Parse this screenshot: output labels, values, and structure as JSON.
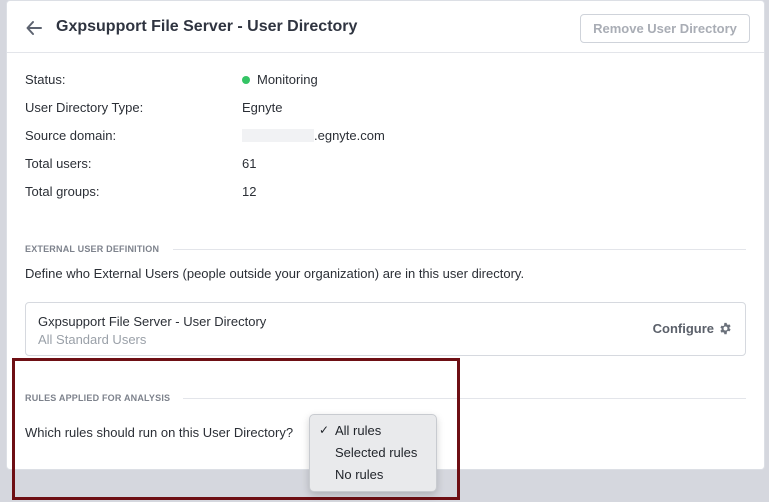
{
  "header": {
    "title": "Gxpsupport File Server - User Directory",
    "remove_label": "Remove User Directory"
  },
  "info": {
    "status_label": "Status:",
    "status_value": "Monitoring",
    "status_color": "#34c465",
    "type_label": "User Directory Type:",
    "type_value": "Egnyte",
    "domain_label": "Source domain:",
    "domain_value": ".egnyte.com",
    "users_label": "Total users:",
    "users_value": "61",
    "groups_label": "Total groups:",
    "groups_value": "12"
  },
  "external": {
    "heading": "EXTERNAL USER DEFINITION",
    "description": "Define who External Users (people outside your organization) are in this user directory.",
    "box_title": "Gxpsupport File Server - User Directory",
    "box_subtitle": "All Standard Users",
    "configure_label": "Configure",
    "configure_icon": "gear-icon"
  },
  "rules": {
    "heading": "RULES APPLIED FOR ANALYSIS",
    "question": "Which rules should run on this User Directory?",
    "options": [
      {
        "label": "All rules",
        "selected": true
      },
      {
        "label": "Selected rules",
        "selected": false
      },
      {
        "label": "No rules",
        "selected": false
      }
    ],
    "check_mark": "✓"
  },
  "colors": {
    "highlight_border": "#6e0f14",
    "accent_green": "#34c465"
  }
}
